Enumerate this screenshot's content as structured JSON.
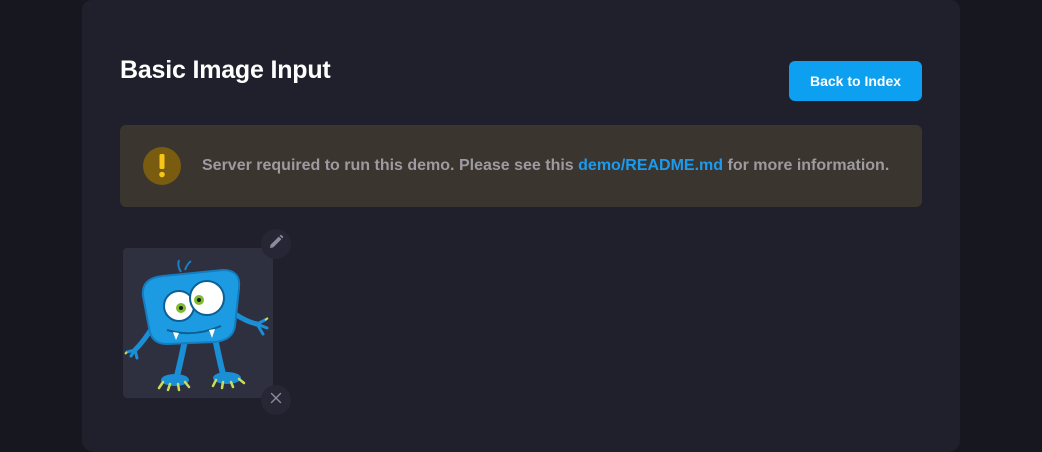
{
  "header": {
    "title": "Basic Image Input",
    "back_label": "Back to Index"
  },
  "notice": {
    "icon": "warning-icon",
    "text_before": "Server required to run this demo. Please see this ",
    "link_text": "demo/README.md",
    "text_after": " for more information."
  },
  "image_input": {
    "edit_icon": "pencil-icon",
    "remove_icon": "close-icon",
    "image": "blue-monster-illustration"
  },
  "colors": {
    "page_bg": "#17171f",
    "panel_bg": "#20202c",
    "accent": "#0ea0f0",
    "notice_bg": "#3b352f",
    "warning": "#f5c518",
    "link": "#1a9bf0"
  }
}
